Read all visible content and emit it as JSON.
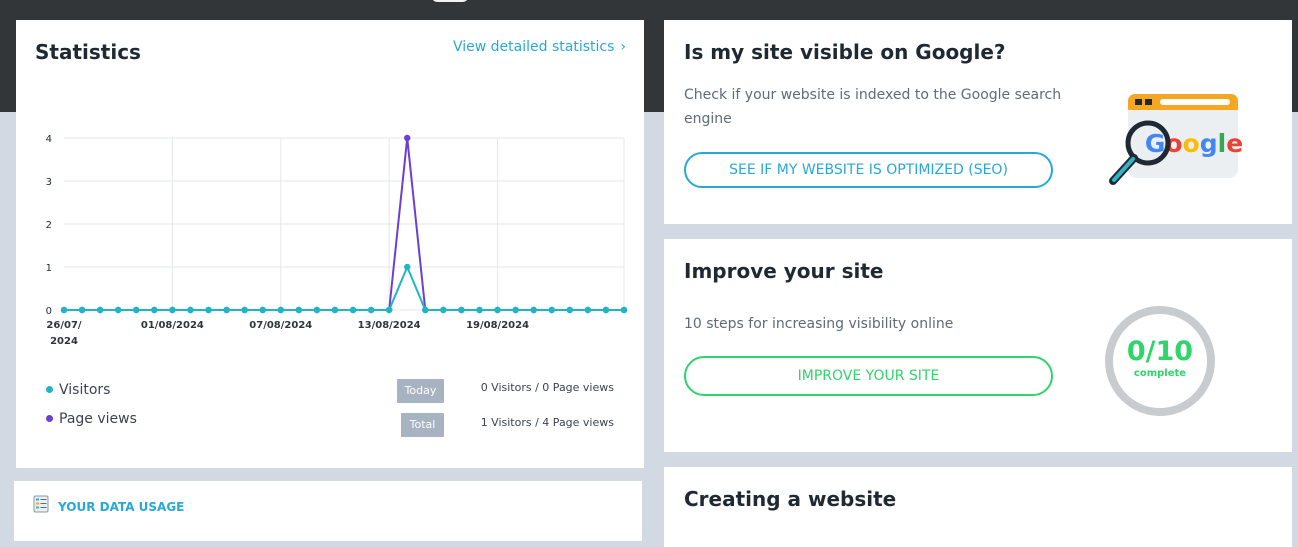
{
  "statistics": {
    "title": "Statistics",
    "link_label": "View detailed statistics",
    "legend": [
      {
        "label": "Visitors",
        "color": "#20b5c4"
      },
      {
        "label": "Page views",
        "color": "#6c3ed6"
      }
    ],
    "today_label": "Today",
    "today_value": "0 Visitors / 0 Page views",
    "total_label": "Total",
    "total_value": "1 Visitors / 4 Page views"
  },
  "chart_data": {
    "type": "line",
    "x": [
      "26/07/2024",
      "27/07/2024",
      "28/07/2024",
      "29/07/2024",
      "30/07/2024",
      "31/07/2024",
      "01/08/2024",
      "02/08/2024",
      "03/08/2024",
      "04/08/2024",
      "05/08/2024",
      "06/08/2024",
      "07/08/2024",
      "08/08/2024",
      "09/08/2024",
      "10/08/2024",
      "11/08/2024",
      "12/08/2024",
      "13/08/2024",
      "14/08/2024",
      "15/08/2024",
      "16/08/2024",
      "17/08/2024",
      "18/08/2024",
      "19/08/2024",
      "20/08/2024",
      "21/08/2024",
      "22/08/2024",
      "23/08/2024",
      "24/08/2024",
      "25/08/2024",
      "26/08/2024"
    ],
    "tick_labels": [
      {
        "index": 0,
        "lines": [
          "26/07/",
          "2024"
        ]
      },
      {
        "index": 6,
        "lines": [
          "01/08/2024"
        ]
      },
      {
        "index": 12,
        "lines": [
          "07/08/2024"
        ]
      },
      {
        "index": 18,
        "lines": [
          "13/08/2024"
        ]
      },
      {
        "index": 24,
        "lines": [
          "19/08/2024"
        ]
      }
    ],
    "series": [
      {
        "name": "Page views",
        "color": "#6c3ed6",
        "values": [
          0,
          0,
          0,
          0,
          0,
          0,
          0,
          0,
          0,
          0,
          0,
          0,
          0,
          0,
          0,
          0,
          0,
          0,
          0,
          4,
          0,
          0,
          0,
          0,
          0,
          0,
          0,
          0,
          0,
          0,
          0,
          0
        ]
      },
      {
        "name": "Visitors",
        "color": "#20b5c4",
        "values": [
          0,
          0,
          0,
          0,
          0,
          0,
          0,
          0,
          0,
          0,
          0,
          0,
          0,
          0,
          0,
          0,
          0,
          0,
          0,
          1,
          0,
          0,
          0,
          0,
          0,
          0,
          0,
          0,
          0,
          0,
          0,
          0
        ]
      }
    ],
    "y_ticks": [
      "0",
      "1",
      "2",
      "3",
      "4"
    ],
    "ylim": [
      0,
      4
    ],
    "grid": true
  },
  "data_usage": {
    "title": "YOUR DATA USAGE",
    "icon": "checklist-icon"
  },
  "google_card": {
    "title": "Is my site visible on Google?",
    "description": "Check if your website is indexed to the Google search engine",
    "button_label": "SEE IF MY WEBSITE IS OPTIMIZED (SEO)",
    "illustration_text": "Google",
    "button_color": "#27a9d8"
  },
  "improve_card": {
    "title": "Improve your site",
    "description": "10 steps for increasing visibility online",
    "button_label": "IMPROVE YOUR SITE",
    "progress_value": "0/10",
    "progress_label": "complete",
    "progress_fraction": 0,
    "accent": "#2fd46a"
  },
  "create_card": {
    "title": "Creating a website"
  }
}
